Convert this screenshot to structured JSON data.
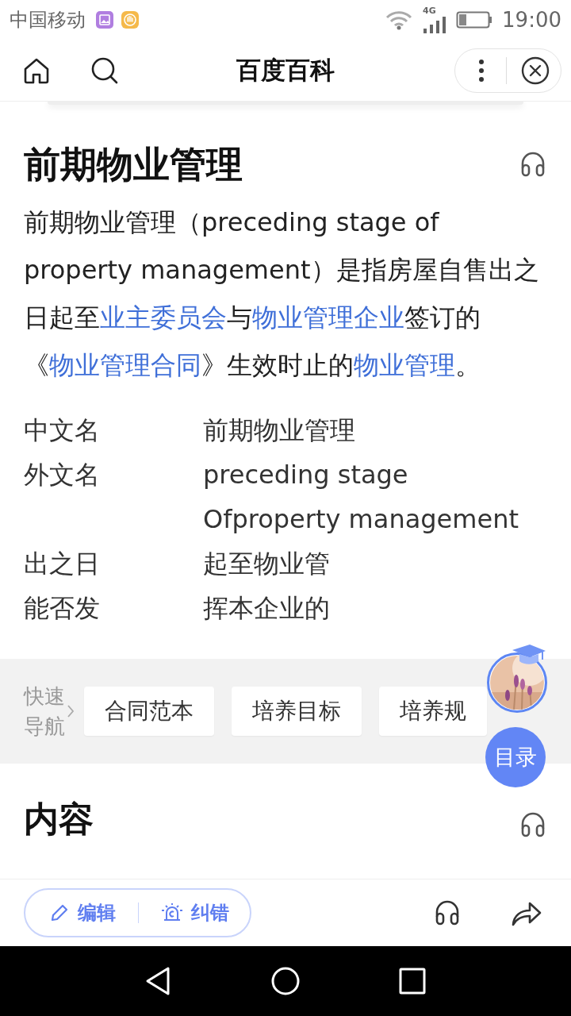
{
  "status_bar": {
    "carrier": "中国移动",
    "network": "4G",
    "time": "19:00"
  },
  "nav_bar": {
    "title": "百度百科"
  },
  "article": {
    "title": "前期物业管理",
    "intro": [
      {
        "kind": "text",
        "text": "前期物业管理（preceding stage of property management）是指房屋自售出之日起至"
      },
      {
        "kind": "link",
        "text": "业主委员会"
      },
      {
        "kind": "text",
        "text": "与"
      },
      {
        "kind": "link",
        "text": "物业管理企业"
      },
      {
        "kind": "text",
        "text": "签订的《"
      },
      {
        "kind": "link",
        "text": "物业管理合同"
      },
      {
        "kind": "text",
        "text": "》生效时止的"
      },
      {
        "kind": "link",
        "text": "物业管理"
      },
      {
        "kind": "text",
        "text": "。"
      }
    ],
    "info": [
      {
        "label": "中文名",
        "value": [
          "前期物业管理"
        ]
      },
      {
        "label": "外文名",
        "value": [
          "preceding stage",
          "Ofproperty management"
        ]
      },
      {
        "label": "出之日",
        "value": [
          "起至物业管"
        ]
      },
      {
        "label": "能否发",
        "value": [
          "挥本企业的"
        ]
      }
    ]
  },
  "quick_nav": {
    "label": "快速导航",
    "items": [
      "合同范本",
      "培养目标",
      "培养规"
    ]
  },
  "toc_button": "目录",
  "next_section": {
    "title": "内容"
  },
  "bottom_bar": {
    "edit": "编辑",
    "report": "纠错"
  }
}
